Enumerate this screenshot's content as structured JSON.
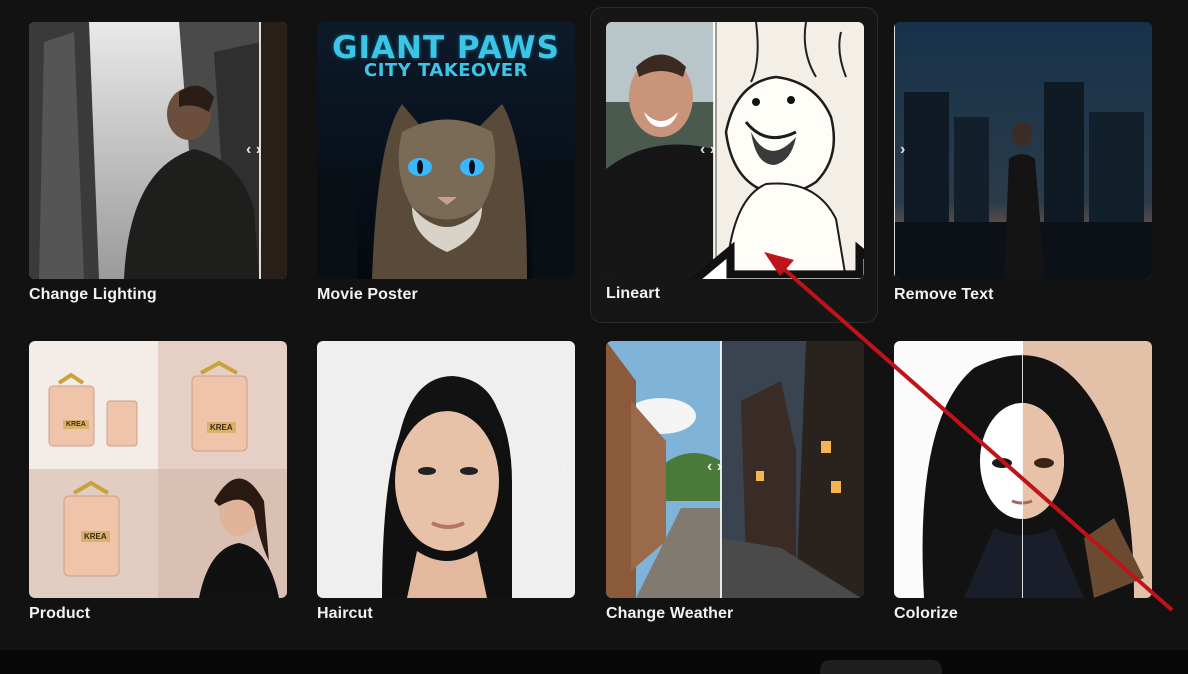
{
  "cards": [
    {
      "id": "change-lighting",
      "label": "Change Lighting"
    },
    {
      "id": "movie-poster",
      "label": "Movie Poster",
      "poster_title": "GIANT PAWS",
      "poster_subtitle": "CITY TAKEOVER"
    },
    {
      "id": "lineart",
      "label": "Lineart"
    },
    {
      "id": "remove-text",
      "label": "Remove Text"
    },
    {
      "id": "product",
      "label": "Product",
      "brand_text": "KREA"
    },
    {
      "id": "haircut",
      "label": "Haircut"
    },
    {
      "id": "change-weather",
      "label": "Change Weather"
    },
    {
      "id": "colorize",
      "label": "Colorize"
    }
  ],
  "icons": {
    "compare_handle": "chevron-left-right-icon",
    "drag_cursor": "horizontal-resize-cursor-icon",
    "annotation": "red-arrow-annotation"
  },
  "colors": {
    "background": "#121212",
    "label_text": "#f2f2f2",
    "annotation_arrow": "#c0121a",
    "poster_title": "#3bc6e8"
  }
}
